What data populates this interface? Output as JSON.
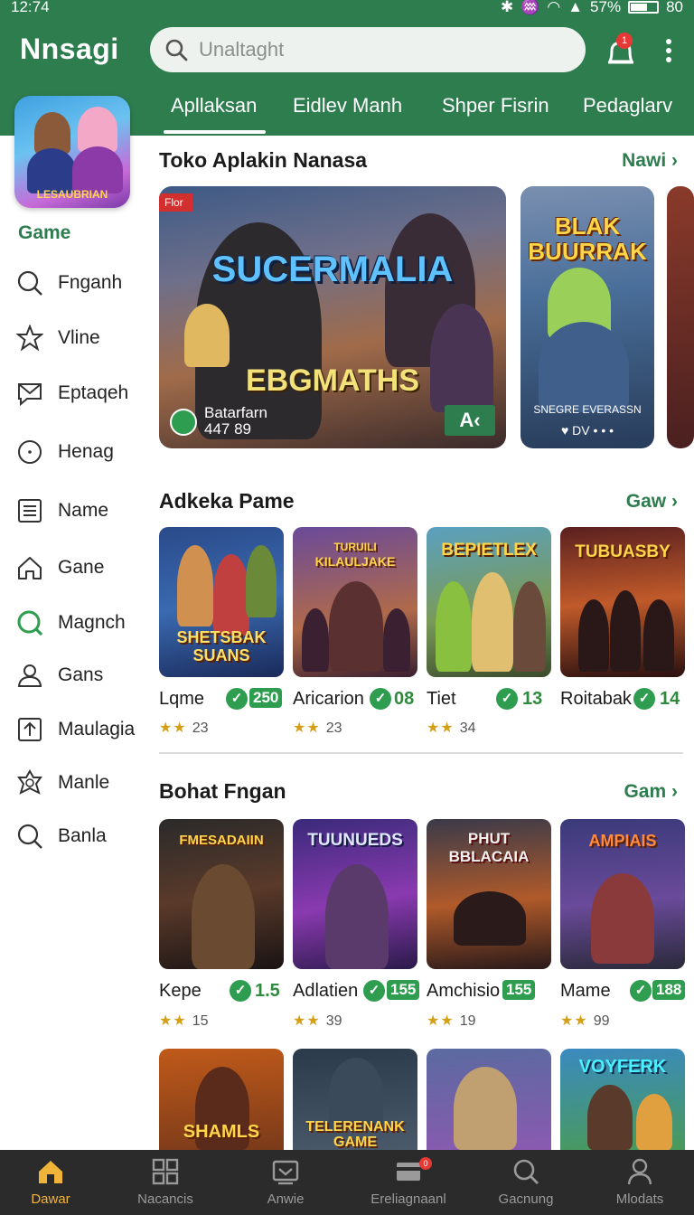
{
  "status": {
    "time": "12:74",
    "battery": "57%",
    "extra": "80"
  },
  "app": {
    "title": "Nnsagi"
  },
  "search": {
    "placeholder": "Unaltaght"
  },
  "notifications": {
    "count": "1"
  },
  "tabs": [
    {
      "label": "Apllaksan",
      "active": true
    },
    {
      "label": "Eidlev Manh",
      "active": false
    },
    {
      "label": "Shper Fisrin",
      "active": false
    },
    {
      "label": "Pedaglarv",
      "active": false
    }
  ],
  "sidebar": {
    "logo_text": "LESAUBRIAN",
    "heading": "Game",
    "items": [
      {
        "label": "Fnganh",
        "icon": "search-icon"
      },
      {
        "label": "Vline",
        "icon": "star-icon"
      },
      {
        "label": "Eptaqeh",
        "icon": "mail-icon"
      },
      {
        "label": "Henag",
        "icon": "clock-icon"
      },
      {
        "label": "Name",
        "icon": "list-icon"
      },
      {
        "label": "Gane",
        "icon": "home-icon"
      },
      {
        "label": "Magnch",
        "icon": "search-icon"
      },
      {
        "label": "Gans",
        "icon": "user-icon"
      },
      {
        "label": "Maulagia",
        "icon": "upload-icon"
      },
      {
        "label": "Manle",
        "icon": "badge-icon"
      },
      {
        "label": "Banla",
        "icon": "search-icon"
      }
    ]
  },
  "featured": {
    "title": "Toko Aplakin Nanasa",
    "link": "Nawi",
    "main": {
      "badge": "Flor",
      "title": "SUCERMALIA",
      "subtitle": "EBGMATHS",
      "dev": "Batarfarn",
      "count": "447 89",
      "button": "A‹"
    },
    "second": {
      "title": "BLAK BUURRAK",
      "caption": "SNEGRE EVERASSN",
      "meta": "♥ DV • • •"
    }
  },
  "section2": {
    "title": "Adkeka Pame",
    "link": "Gaw",
    "cards": [
      {
        "art_top": "",
        "art_title": "SHETSBAK SUANS",
        "name": "Lqme",
        "badge": "250",
        "badge_style": "box",
        "rating": "23"
      },
      {
        "art_top": "TURUILI",
        "art_title": "KILAULJAKE",
        "name": "Aricarion",
        "badge": "08",
        "badge_style": "plain",
        "rating": "23"
      },
      {
        "art_top": "",
        "art_title": "BEPIETLEX",
        "name": "Tiet",
        "badge": "13",
        "badge_style": "plain",
        "rating": "34"
      },
      {
        "art_top": "",
        "art_title": "TUBUASBY",
        "name": "Roitabak",
        "badge": "14",
        "badge_style": "plain",
        "rating": ""
      }
    ]
  },
  "section3": {
    "title": "Bohat Fngan",
    "link": "Gam",
    "cards": [
      {
        "art_title": "FMESADAIIN",
        "name": "Kepe",
        "badge": "1.5",
        "badge_style": "plain",
        "rating": "15"
      },
      {
        "art_title": "TUUNUEDS",
        "name": "Adlatien",
        "badge": "155",
        "badge_style": "box",
        "rating": "39"
      },
      {
        "art_title": "PHUT BBLACAIA",
        "name": "Amchisio",
        "badge": "155",
        "badge_style": "box",
        "rating": "19"
      },
      {
        "art_title": "AMPIAIS",
        "name": "Mame",
        "badge": "188",
        "badge_style": "box",
        "rating": "99"
      }
    ]
  },
  "section4": {
    "cards": [
      {
        "art_title": "SHAMLS"
      },
      {
        "art_title": "TELERENANK GAME"
      },
      {
        "art_title": ""
      },
      {
        "art_title": "VOYFERK"
      }
    ]
  },
  "bottom_nav": [
    {
      "label": "Dawar",
      "icon": "home-icon",
      "active": true
    },
    {
      "label": "Nacancis",
      "icon": "grid-icon",
      "active": false
    },
    {
      "label": "Anwie",
      "icon": "inbox-icon",
      "active": false
    },
    {
      "label": "Ereliagnaanl",
      "icon": "card-icon",
      "active": false,
      "badge": "0"
    },
    {
      "label": "Gacnung",
      "icon": "search-icon",
      "active": false
    },
    {
      "label": "Mlodats",
      "icon": "user-icon",
      "active": false
    }
  ],
  "colors": {
    "brand": "#2e7d4f",
    "nav_bg": "#2b2b2b",
    "active_nav": "#f0b43a",
    "badge": "#e53935"
  }
}
